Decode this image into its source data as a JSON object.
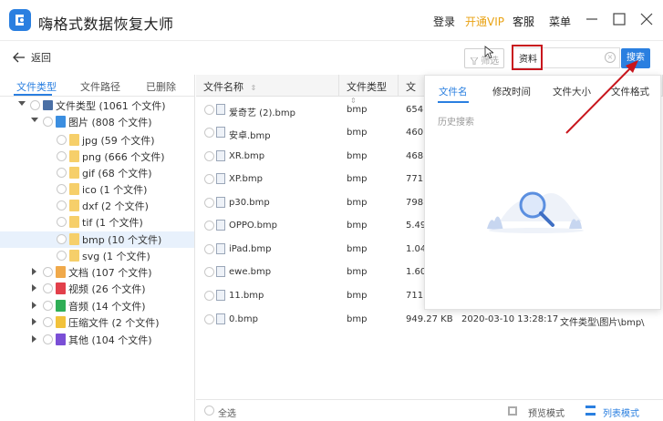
{
  "app": {
    "title": "嗨格式数据恢复大师",
    "login": "登录",
    "vip": "开通VIP",
    "service": "客服",
    "menu": "菜单"
  },
  "toolbar": {
    "back": "返回",
    "filter": "筛选",
    "search_value": "资料",
    "search_button": "搜索"
  },
  "left_tabs": [
    "文件类型",
    "文件路径",
    "已删除"
  ],
  "tree": [
    {
      "label": "文件类型 (1061 个文件)"
    },
    {
      "label": "图片 (808 个文件)"
    },
    {
      "label": "jpg (59 个文件)"
    },
    {
      "label": "png (666 个文件)"
    },
    {
      "label": "gif (68 个文件)"
    },
    {
      "label": "ico (1 个文件)"
    },
    {
      "label": "dxf (2 个文件)"
    },
    {
      "label": "tif (1 个文件)"
    },
    {
      "label": "bmp (10 个文件)"
    },
    {
      "label": "svg (1 个文件)"
    },
    {
      "label": "文档 (107 个文件)"
    },
    {
      "label": "视频 (26 个文件)"
    },
    {
      "label": "音频 (14 个文件)"
    },
    {
      "label": "压缩文件 (2 个文件)"
    },
    {
      "label": "其他 (104 个文件)"
    }
  ],
  "table": {
    "headers": [
      "文件名称",
      "文件类型",
      "文"
    ],
    "rows": [
      {
        "name": "爱奇艺 (2).bmp",
        "type": "bmp",
        "size": "654."
      },
      {
        "name": "安卓.bmp",
        "type": "bmp",
        "size": "460."
      },
      {
        "name": "XR.bmp",
        "type": "bmp",
        "size": "468."
      },
      {
        "name": "XP.bmp",
        "type": "bmp",
        "size": "771."
      },
      {
        "name": "p30.bmp",
        "type": "bmp",
        "size": "798."
      },
      {
        "name": "OPPO.bmp",
        "type": "bmp",
        "size": "5.49"
      },
      {
        "name": "iPad.bmp",
        "type": "bmp",
        "size": "1.04"
      },
      {
        "name": "ewe.bmp",
        "type": "bmp",
        "size": "1.60"
      },
      {
        "name": "11.bmp",
        "type": "bmp",
        "size": "711."
      },
      {
        "name": "0.bmp",
        "type": "bmp",
        "size": "949.27 KB",
        "time": "2020-03-10 13:28:17",
        "path": "文件类型\\图片\\bmp\\"
      }
    ]
  },
  "footer": {
    "select_all": "全选",
    "preview_mode": "预览模式",
    "list_mode": "列表模式"
  },
  "popup": {
    "tabs": [
      "文件名",
      "修改时间",
      "文件大小",
      "文件格式"
    ],
    "history": "历史搜索"
  },
  "colors": {
    "accent": "#2a7fe0",
    "vip": "#e9a213",
    "annotation_red": "#c8161d"
  }
}
